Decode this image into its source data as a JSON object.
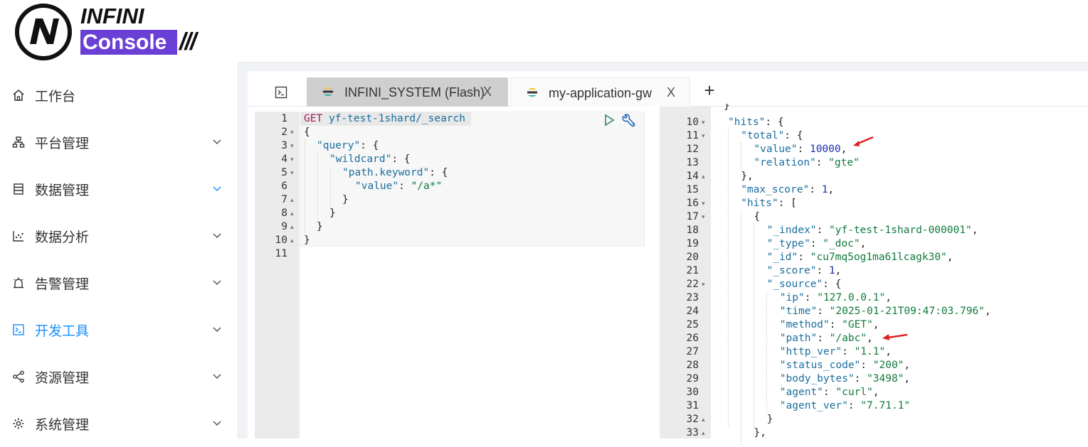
{
  "logo": {
    "top_text": "INFINI",
    "box_text": "Console",
    "slashes": "///"
  },
  "sidebar": {
    "items": [
      {
        "label": "工作台",
        "icon": "home-icon",
        "has_caret": false
      },
      {
        "label": "平台管理",
        "icon": "cluster-icon",
        "has_caret": true
      },
      {
        "label": "数据管理",
        "icon": "database-icon",
        "has_caret": true
      },
      {
        "label": "数据分析",
        "icon": "chart-icon",
        "has_caret": true
      },
      {
        "label": "告警管理",
        "icon": "alarm-icon",
        "has_caret": true
      },
      {
        "label": "开发工具",
        "icon": "console-icon",
        "has_caret": true,
        "active": true
      },
      {
        "label": "资源管理",
        "icon": "share-icon",
        "has_caret": true
      },
      {
        "label": "系统管理",
        "icon": "gear-icon",
        "has_caret": true
      }
    ]
  },
  "tabs": [
    {
      "label": "INFINI_SYSTEM (Flash)",
      "close": "X",
      "active": true
    },
    {
      "label": "my-application-gw",
      "close": "X",
      "active": false
    }
  ],
  "add_tab": "+",
  "request": {
    "lines": [
      {
        "n": "1",
        "fold": ""
      },
      {
        "n": "2",
        "fold": "▾"
      },
      {
        "n": "3",
        "fold": "▾"
      },
      {
        "n": "4",
        "fold": "▾"
      },
      {
        "n": "5",
        "fold": "▾"
      },
      {
        "n": "6",
        "fold": ""
      },
      {
        "n": "7",
        "fold": "▴"
      },
      {
        "n": "8",
        "fold": "▴"
      },
      {
        "n": "9",
        "fold": "▴"
      },
      {
        "n": "10",
        "fold": "▴"
      },
      {
        "n": "11",
        "fold": ""
      }
    ],
    "method": "GET",
    "url": "yf-test-1shard/_search",
    "query_key": "\"query\"",
    "wildcard_key": "\"wildcard\"",
    "path_key": "\"path.keyword\"",
    "value_key": "\"value\"",
    "value_val": "\"/a*\""
  },
  "response": {
    "lines": [
      {
        "n": "10",
        "fold": "▾"
      },
      {
        "n": "11",
        "fold": "▾"
      },
      {
        "n": "12",
        "fold": ""
      },
      {
        "n": "13",
        "fold": ""
      },
      {
        "n": "14",
        "fold": "▴"
      },
      {
        "n": "15",
        "fold": ""
      },
      {
        "n": "16",
        "fold": "▾"
      },
      {
        "n": "17",
        "fold": "▾"
      },
      {
        "n": "18",
        "fold": ""
      },
      {
        "n": "19",
        "fold": ""
      },
      {
        "n": "20",
        "fold": ""
      },
      {
        "n": "21",
        "fold": ""
      },
      {
        "n": "22",
        "fold": "▾"
      },
      {
        "n": "23",
        "fold": ""
      },
      {
        "n": "24",
        "fold": ""
      },
      {
        "n": "25",
        "fold": ""
      },
      {
        "n": "26",
        "fold": ""
      },
      {
        "n": "27",
        "fold": ""
      },
      {
        "n": "28",
        "fold": ""
      },
      {
        "n": "29",
        "fold": ""
      },
      {
        "n": "30",
        "fold": ""
      },
      {
        "n": "31",
        "fold": ""
      },
      {
        "n": "32",
        "fold": "▴"
      },
      {
        "n": "33",
        "fold": "▴"
      }
    ],
    "code": [
      {
        "indent": 0,
        "parts": [
          [
            "k",
            "\"hits\""
          ],
          [
            "p",
            ": {"
          ]
        ]
      },
      {
        "indent": 1,
        "parts": [
          [
            "k",
            "\"total\""
          ],
          [
            "p",
            ": {"
          ]
        ]
      },
      {
        "indent": 2,
        "parts": [
          [
            "k",
            "\"value\""
          ],
          [
            "p",
            ": "
          ],
          [
            "n",
            "10000"
          ],
          [
            "p",
            ","
          ]
        ]
      },
      {
        "indent": 2,
        "parts": [
          [
            "k",
            "\"relation\""
          ],
          [
            "p",
            ": "
          ],
          [
            "s",
            "\"gte\""
          ]
        ]
      },
      {
        "indent": 1,
        "parts": [
          [
            "p",
            "},"
          ]
        ]
      },
      {
        "indent": 1,
        "parts": [
          [
            "k",
            "\"max_score\""
          ],
          [
            "p",
            ": "
          ],
          [
            "n",
            "1"
          ],
          [
            "p",
            ","
          ]
        ]
      },
      {
        "indent": 1,
        "parts": [
          [
            "k",
            "\"hits\""
          ],
          [
            "p",
            ": ["
          ]
        ]
      },
      {
        "indent": 2,
        "parts": [
          [
            "p",
            "{"
          ]
        ]
      },
      {
        "indent": 3,
        "parts": [
          [
            "k",
            "\"_index\""
          ],
          [
            "p",
            ": "
          ],
          [
            "s",
            "\"yf-test-1shard-000001\""
          ],
          [
            "p",
            ","
          ]
        ]
      },
      {
        "indent": 3,
        "parts": [
          [
            "k",
            "\"_type\""
          ],
          [
            "p",
            ": "
          ],
          [
            "s",
            "\"_doc\""
          ],
          [
            "p",
            ","
          ]
        ]
      },
      {
        "indent": 3,
        "parts": [
          [
            "k",
            "\"_id\""
          ],
          [
            "p",
            ": "
          ],
          [
            "s",
            "\"cu7mq5og1ma61lcagk30\""
          ],
          [
            "p",
            ","
          ]
        ]
      },
      {
        "indent": 3,
        "parts": [
          [
            "k",
            "\"_score\""
          ],
          [
            "p",
            ": "
          ],
          [
            "n",
            "1"
          ],
          [
            "p",
            ","
          ]
        ]
      },
      {
        "indent": 3,
        "parts": [
          [
            "k",
            "\"_source\""
          ],
          [
            "p",
            ": {"
          ]
        ]
      },
      {
        "indent": 4,
        "parts": [
          [
            "k",
            "\"ip\""
          ],
          [
            "p",
            ": "
          ],
          [
            "s",
            "\"127.0.0.1\""
          ],
          [
            "p",
            ","
          ]
        ]
      },
      {
        "indent": 4,
        "parts": [
          [
            "k",
            "\"time\""
          ],
          [
            "p",
            ": "
          ],
          [
            "s",
            "\"2025-01-21T09:47:03.796\""
          ],
          [
            "p",
            ","
          ]
        ]
      },
      {
        "indent": 4,
        "parts": [
          [
            "k",
            "\"method\""
          ],
          [
            "p",
            ": "
          ],
          [
            "s",
            "\"GET\""
          ],
          [
            "p",
            ","
          ]
        ]
      },
      {
        "indent": 4,
        "parts": [
          [
            "k",
            "\"path\""
          ],
          [
            "p",
            ": "
          ],
          [
            "s",
            "\"/abc\""
          ],
          [
            "p",
            ","
          ]
        ]
      },
      {
        "indent": 4,
        "parts": [
          [
            "k",
            "\"http_ver\""
          ],
          [
            "p",
            ": "
          ],
          [
            "s",
            "\"1.1\""
          ],
          [
            "p",
            ","
          ]
        ]
      },
      {
        "indent": 4,
        "parts": [
          [
            "k",
            "\"status_code\""
          ],
          [
            "p",
            ": "
          ],
          [
            "s",
            "\"200\""
          ],
          [
            "p",
            ","
          ]
        ]
      },
      {
        "indent": 4,
        "parts": [
          [
            "k",
            "\"body_bytes\""
          ],
          [
            "p",
            ": "
          ],
          [
            "s",
            "\"3498\""
          ],
          [
            "p",
            ","
          ]
        ]
      },
      {
        "indent": 4,
        "parts": [
          [
            "k",
            "\"agent\""
          ],
          [
            "p",
            ": "
          ],
          [
            "s",
            "\"curl\""
          ],
          [
            "p",
            ","
          ]
        ]
      },
      {
        "indent": 4,
        "parts": [
          [
            "k",
            "\"agent_ver\""
          ],
          [
            "p",
            ": "
          ],
          [
            "s",
            "\"7.71.1\""
          ]
        ]
      },
      {
        "indent": 3,
        "parts": [
          [
            "p",
            "}"
          ]
        ]
      },
      {
        "indent": 2,
        "parts": [
          [
            "p",
            "},"
          ]
        ]
      }
    ]
  },
  "colors": {
    "accent": "#1890ff",
    "annotation_arrow": "#e02020",
    "logo_purple": "#6a3fd6"
  }
}
